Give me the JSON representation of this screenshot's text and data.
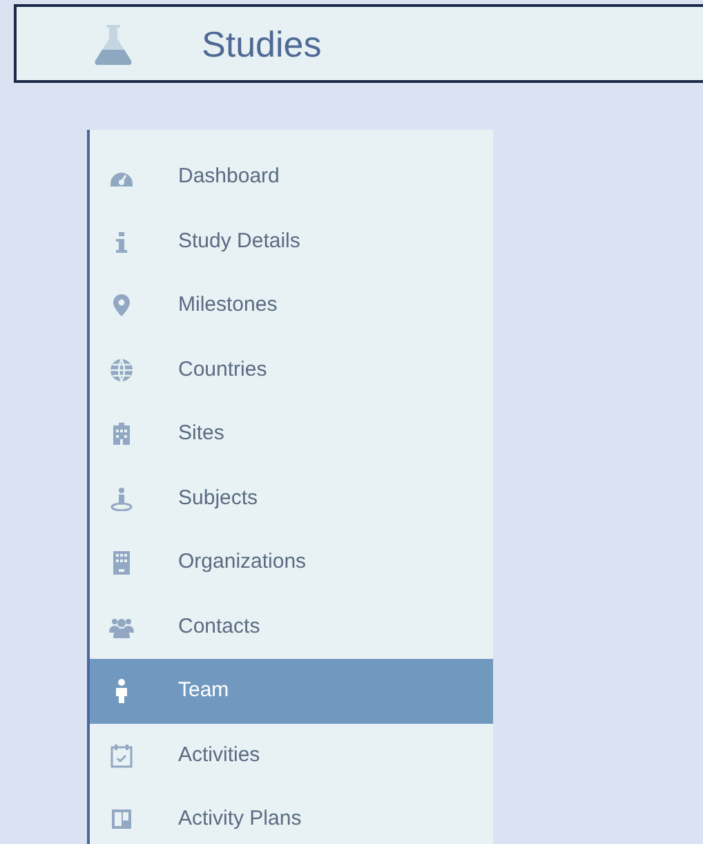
{
  "header": {
    "title": "Studies"
  },
  "sidebar": {
    "items": [
      {
        "label": "Dashboard",
        "selected": false
      },
      {
        "label": "Study Details",
        "selected": false
      },
      {
        "label": "Milestones",
        "selected": false
      },
      {
        "label": "Countries",
        "selected": false
      },
      {
        "label": "Sites",
        "selected": false
      },
      {
        "label": "Subjects",
        "selected": false
      },
      {
        "label": "Organizations",
        "selected": false
      },
      {
        "label": "Contacts",
        "selected": false
      },
      {
        "label": "Team",
        "selected": true
      },
      {
        "label": "Activities",
        "selected": false
      },
      {
        "label": "Activity Plans",
        "selected": false
      }
    ]
  }
}
